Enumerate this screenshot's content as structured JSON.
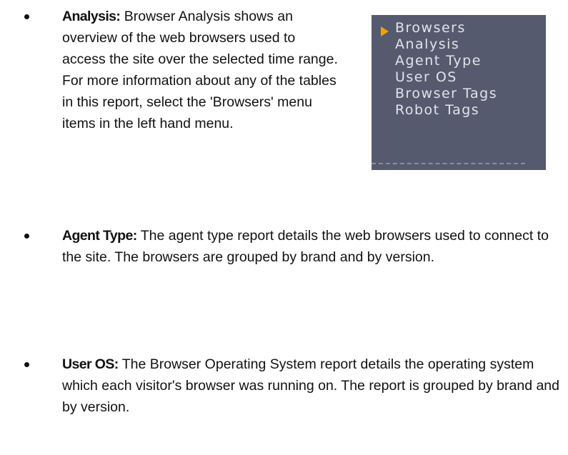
{
  "items": [
    {
      "term": "Analysis:",
      "text": "Browser Analysis shows an overview of the web browsers used to access the site over the selected time range. For more information about any of the tables in this report, select the 'Browsers' menu items in the left hand menu."
    },
    {
      "term": "Agent Type:",
      "text": "The agent type report details the web browsers used to connect to the site. The browsers are grouped by brand and by version."
    },
    {
      "term": "User OS:",
      "text": "The Browser Operating System report details the operating system which each visitor's browser was running on. The report is grouped by brand and by version."
    }
  ],
  "menu": {
    "items": [
      "Browsers",
      "Analysis",
      "Agent Type",
      "User OS",
      "Browser Tags",
      "Robot Tags"
    ],
    "arrow_color": "#f5a000",
    "background": "#555a6e",
    "text_color": "#e2e3ea"
  }
}
